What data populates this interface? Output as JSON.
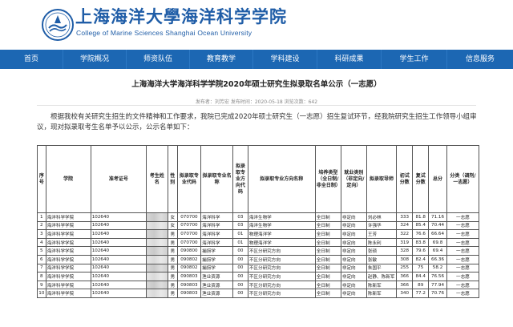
{
  "header": {
    "logo_cn": "上海海洋大學海洋科学学院",
    "logo_en": "College of Marine Sciences Shanghai Ocean University",
    "colors": {
      "brand_blue": "#1f5da7",
      "nav_blue": "#1c67b3"
    }
  },
  "nav": {
    "items": [
      "首页",
      "学院概况",
      "师资队伍",
      "教育教学",
      "学科建设",
      "科研成果",
      "学生工作",
      "信息服务"
    ]
  },
  "article": {
    "title": "上海海洋大学海洋科学学院2020年硕士研究生拟录取名单公示（一志愿）",
    "meta": "发布者：刘芳宏    发布时间：2020-05-18    浏览次数：642",
    "intro": "根据我校有关研究生招生的文件精神和工作要求，我院已完成2020年硕士研究生（一志愿）招生复试环节，经我院研究生招生工作领导小组审议，现对拟录取考生名单予以公示，公示名单如下："
  },
  "table": {
    "headers": [
      "序号",
      "学院",
      "准考证号",
      "考生姓名",
      "性别",
      "拟录取专业代码",
      "拟录取专业名称",
      "拟录取专业方向代码",
      "拟录取专业方向名称",
      "培养类型（全日制/非全日制）",
      "就业类别（非定向/定向）",
      "拟录取导师",
      "初试分数",
      "复试分数",
      "总分",
      "分类（调剂/一志愿）"
    ],
    "rows": [
      [
        "1",
        "海洋科学学院",
        "102640",
        "",
        "女",
        "070700",
        "海洋科学",
        "03",
        "海洋生物学",
        "全日制",
        "非定向",
        "刘必林",
        "333",
        "81.8",
        "71.16",
        "一志愿"
      ],
      [
        "2",
        "海洋科学学院",
        "102640",
        "",
        "女",
        "070700",
        "海洋科学",
        "03",
        "海洋生物学",
        "全日制",
        "非定向",
        "许强华",
        "324",
        "85.4",
        "70.44",
        "一志愿"
      ],
      [
        "3",
        "海洋科学学院",
        "102640",
        "",
        "男",
        "070700",
        "海洋科学",
        "01",
        "物理海洋学",
        "全日制",
        "非定向",
        "王芳",
        "322",
        "76.6",
        "66.64",
        "一志愿"
      ],
      [
        "4",
        "海洋科学学院",
        "102640",
        "",
        "男",
        "070700",
        "海洋科学",
        "01",
        "物理海洋学",
        "全日制",
        "非定向",
        "陈永利",
        "319",
        "83.8",
        "69.8",
        "一志愿"
      ],
      [
        "5",
        "海洋科学学院",
        "102640",
        "",
        "男",
        "090800",
        "捕捞学",
        "00",
        "不区分研究方向",
        "全日制",
        "非定向",
        "张硕",
        "328",
        "79.6",
        "69.4",
        "一志愿"
      ],
      [
        "6",
        "海洋科学学院",
        "102640",
        "",
        "男",
        "090802",
        "捕捞学",
        "00",
        "不区分研究方向",
        "全日制",
        "非定向",
        "张敏",
        "308",
        "82.4",
        "66.36",
        "一志愿"
      ],
      [
        "7",
        "海洋科学学院",
        "102640",
        "",
        "男",
        "090802",
        "捕捞学",
        "00",
        "不区分研究方向",
        "全日制",
        "非定向",
        "朱国平",
        "255",
        "75",
        "58.2",
        "一志愿"
      ],
      [
        "8",
        "海洋科学学院",
        "102640",
        "",
        "男",
        "090803",
        "渔业资源",
        "00",
        "不区分研究方向",
        "全日制",
        "非定向",
        "赵静、陈新军",
        "366",
        "84.4",
        "76.56",
        "一志愿"
      ],
      [
        "9",
        "海洋科学学院",
        "102640",
        "",
        "男",
        "090803",
        "渔业资源",
        "00",
        "不区分研究方向",
        "全日制",
        "非定向",
        "陈新军",
        "366",
        "89",
        "77.94",
        "一志愿"
      ],
      [
        "10",
        "海洋科学学院",
        "102640",
        "",
        "男",
        "090803",
        "渔业资源",
        "00",
        "不区分研究方向",
        "全日制",
        "非定向",
        "陈新军",
        "340",
        "77.2",
        "70.76",
        "一志愿"
      ]
    ]
  }
}
